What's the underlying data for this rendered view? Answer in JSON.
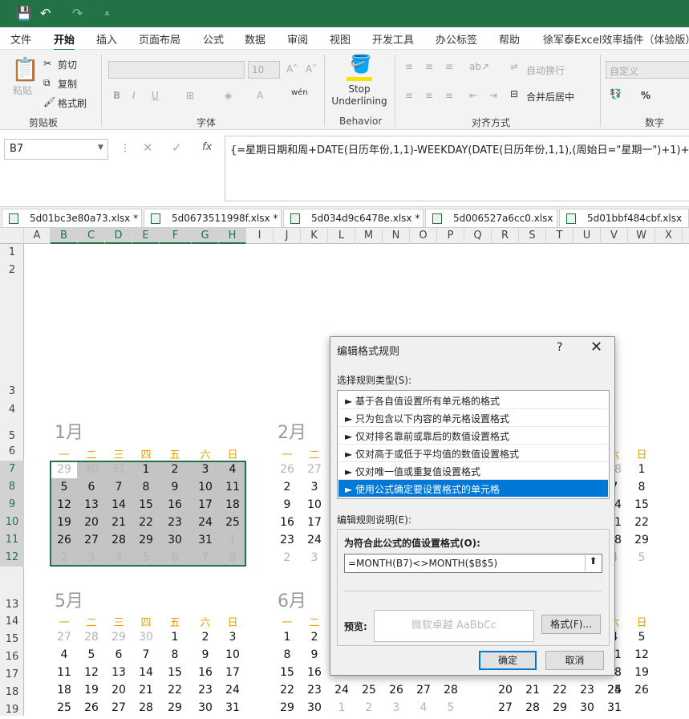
{
  "qat": {
    "save_icon": "save-icon",
    "undo_icon": "undo-icon",
    "redo_icon": "redo-icon",
    "customize_icon": "customize-icon"
  },
  "menu": {
    "tabs": [
      "文件",
      "开始",
      "插入",
      "页面布局",
      "公式",
      "数据",
      "审阅",
      "视图",
      "开发工具",
      "办公标签",
      "帮助",
      "徐军泰Excel效率插件（体验版）"
    ],
    "active": "开始"
  },
  "ribbon": {
    "paste": "粘贴",
    "cut": "剪切",
    "copy": "复制",
    "format_painter": "格式刷",
    "clipboard_label": "剪贴板",
    "font_size": "10",
    "font_label": "字体",
    "stop_underlining": "Stop Underlining",
    "behavior_label": "Behavior",
    "wrap_text": "自动换行",
    "merge_center": "合并后居中",
    "alignment_label": "对齐方式",
    "number_format": "自定义",
    "number_label": "数字",
    "percent": "%"
  },
  "formula_bar": {
    "name_box": "B7",
    "fx": "fx",
    "formula": "{=星期日期和周+DATE(日历年份,1,1)-WEEKDAY(DATE(日历年份,1,1),(周始日=\"星期一\")+1)+"
  },
  "workbook_tabs": [
    "5d01bc3e80a73.xlsx *",
    "5d0673511998f.xlsx *",
    "5d034d9c6478e.xlsx *",
    "5d006527a6cc0.xlsx",
    "5d01bbf484cbf.xlsx"
  ],
  "columns": [
    "A",
    "B",
    "C",
    "D",
    "E",
    "F",
    "G",
    "H",
    "I",
    "J",
    "K",
    "L",
    "M",
    "N",
    "O",
    "P",
    "Q",
    "R",
    "S",
    "T",
    "U",
    "V",
    "W",
    "X"
  ],
  "rows": [
    "1",
    "2",
    "3",
    "4",
    "5",
    "6",
    "7",
    "8",
    "9",
    "10",
    "11",
    "12",
    "13",
    "14",
    "15",
    "16",
    "17",
    "18",
    "19",
    "20"
  ],
  "weekdays": [
    "一",
    "二",
    "三",
    "四",
    "五",
    "六",
    "日"
  ],
  "months": {
    "jan": {
      "title": "1月",
      "weeks": [
        [
          "29",
          "30",
          "31",
          "1",
          "2",
          "3",
          "4"
        ],
        [
          "5",
          "6",
          "7",
          "8",
          "9",
          "10",
          "11"
        ],
        [
          "12",
          "13",
          "14",
          "15",
          "16",
          "17",
          "18"
        ],
        [
          "19",
          "20",
          "21",
          "22",
          "23",
          "24",
          "25"
        ],
        [
          "26",
          "27",
          "28",
          "29",
          "30",
          "31",
          "1"
        ],
        [
          "2",
          "3",
          "4",
          "5",
          "6",
          "7",
          "8"
        ]
      ]
    },
    "feb": {
      "title": "2月",
      "weeks": [
        [
          "26",
          "27"
        ],
        [
          "2",
          "3"
        ],
        [
          "9",
          "10"
        ],
        [
          "16",
          "17"
        ],
        [
          "23",
          "24"
        ],
        [
          "2",
          "3"
        ]
      ],
      "right_cols": [
        [
          "28",
          "1"
        ],
        [
          "7",
          "8"
        ],
        [
          "14",
          "15"
        ],
        [
          "21",
          "22"
        ],
        [
          "28",
          "29"
        ],
        [
          "4",
          "5"
        ]
      ],
      "right_weekdays": [
        "六",
        "日"
      ]
    },
    "may": {
      "title": "5月",
      "weeks": [
        [
          "27",
          "28",
          "29",
          "30",
          "1",
          "2",
          "3"
        ],
        [
          "4",
          "5",
          "6",
          "7",
          "8",
          "9",
          "10"
        ],
        [
          "11",
          "12",
          "13",
          "14",
          "15",
          "16",
          "17"
        ],
        [
          "18",
          "19",
          "20",
          "21",
          "22",
          "23",
          "24"
        ],
        [
          "25",
          "26",
          "27",
          "28",
          "29",
          "30",
          "31"
        ]
      ]
    },
    "jun": {
      "title": "6月",
      "weeks": [
        [
          "1",
          "2"
        ],
        [
          "8",
          "9"
        ],
        [
          "15",
          "16"
        ],
        [
          "22",
          "23",
          "24",
          "25",
          "26",
          "27",
          "28"
        ],
        [
          "29",
          "30",
          "1",
          "2",
          "3",
          "4",
          "5"
        ]
      ]
    },
    "jul_right": {
      "weekdays": [
        "六",
        "日"
      ],
      "cols": [
        [
          "4",
          "5"
        ],
        [
          "11",
          "12"
        ],
        [
          "18",
          "19"
        ],
        [
          "25",
          "26"
        ]
      ],
      "partial": [
        "20",
        "21",
        "22",
        "23",
        "24"
      ],
      "last": [
        "27",
        "28",
        "29",
        "30",
        "31",
        "1",
        "2"
      ]
    }
  },
  "dialog": {
    "title": "编辑格式规则",
    "help": "?",
    "close": "✕",
    "rule_type_label": "选择规则类型(S):",
    "rule_types": [
      "► 基于各自值设置所有单元格的格式",
      "► 只为包含以下内容的单元格设置格式",
      "► 仅对排名靠前或靠后的数值设置格式",
      "► 仅对高于或低于平均值的数值设置格式",
      "► 仅对唯一值或重复值设置格式",
      "► 使用公式确定要设置格式的单元格"
    ],
    "selected_index": 5,
    "desc_label": "编辑规则说明(E):",
    "formula_label": "为符合此公式的值设置格式(O):",
    "formula_value": "=MONTH(B7)<>MONTH($B$5)",
    "preview_label": "预览:",
    "preview_text": "微软卓越  AaBbCc",
    "format_button": "格式(F)...",
    "ok": "确定",
    "cancel": "取消"
  }
}
